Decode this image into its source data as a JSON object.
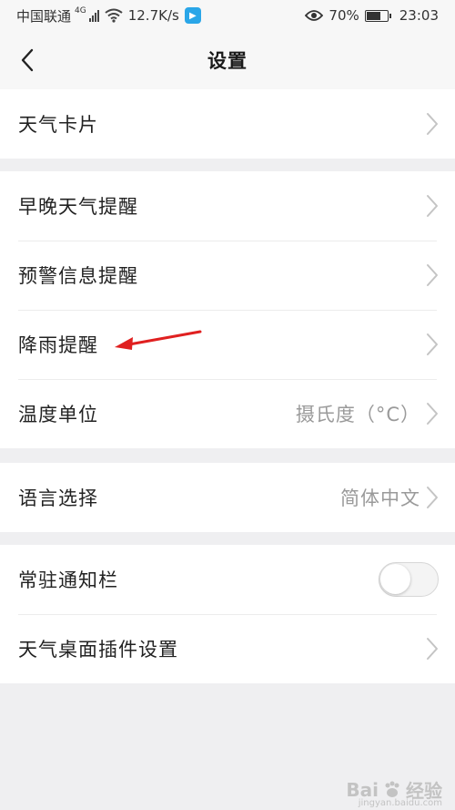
{
  "status_bar": {
    "carrier": "中国联通",
    "network_type": "4G",
    "speed": "12.7K/s",
    "battery_percent": "70%",
    "battery_level": 0.7,
    "time": "23:03"
  },
  "header": {
    "title": "设置"
  },
  "groups": {
    "g1": [
      {
        "label": "天气卡片"
      }
    ],
    "g2": [
      {
        "label": "早晚天气提醒"
      },
      {
        "label": "预警信息提醒"
      },
      {
        "label": "降雨提醒"
      },
      {
        "label": "温度单位",
        "value": "摄氏度（°C）"
      }
    ],
    "g3": [
      {
        "label": "语言选择",
        "value": "简体中文"
      }
    ],
    "g4": [
      {
        "label": "常驻通知栏",
        "toggle_on": false
      },
      {
        "label": "天气桌面插件设置"
      }
    ]
  },
  "annotation_color": "#e02020",
  "watermark": {
    "brand": "Bai",
    "product": "经验",
    "url": "jingyan.baidu.com"
  }
}
